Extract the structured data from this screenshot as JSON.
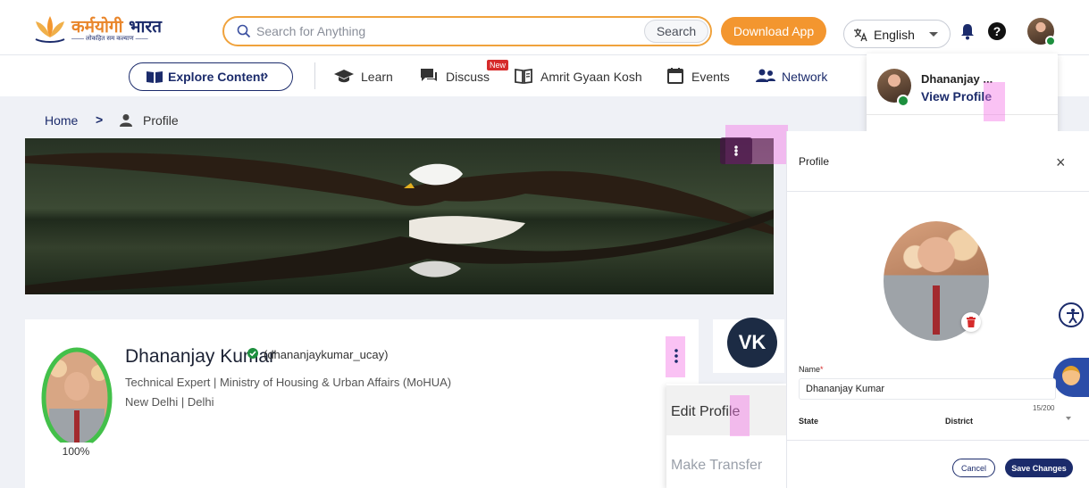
{
  "header": {
    "logo": {
      "title_part1": "कर्मयोगी",
      "title_part2": " भारत",
      "tagline": "—— लोकहित सम कल्याण ——"
    },
    "search": {
      "placeholder": "Search for Anything",
      "button_label": "Search"
    },
    "download_label": "Download App",
    "language": "English"
  },
  "nav": {
    "explore_label": "Explore Content",
    "explore_chevron": "›",
    "items": [
      {
        "label": "Learn",
        "icon": "graduation-cap-icon"
      },
      {
        "label": "Discuss",
        "icon": "discussion-icon",
        "badge": "New"
      },
      {
        "label": "Amrit Gyaan Kosh",
        "icon": "book-icon"
      },
      {
        "label": "Events",
        "icon": "calendar-icon"
      },
      {
        "label": "Network",
        "icon": "people-icon"
      }
    ]
  },
  "breadcrumb": {
    "home": "Home",
    "separator": ">",
    "current": "Profile"
  },
  "profile": {
    "name": "Dhananjay Kumar",
    "handle": "(dhananjaykumar_ucay)",
    "designation": "Technical Expert | Ministry of Housing & Urban Affairs (MoHUA)",
    "location": "New Delhi | Delhi",
    "completion": 100,
    "completion_label": "100%"
  },
  "network_card": {
    "initials": "VK"
  },
  "context_menu": {
    "edit_label": "Edit Profile",
    "transfer_label": "Make Transfer Request"
  },
  "user_menu": {
    "name": "Dhananjay ...",
    "view_profile": "View Profile"
  },
  "panel": {
    "title": "Profile",
    "close_glyph": "×",
    "name_label": "Name",
    "required_mark": "*",
    "name_value": "Dhananjay Kumar",
    "char_count": "15/200",
    "state_label": "State",
    "district_label": "District",
    "cancel_label": "Cancel",
    "save_label": "Save Changes"
  },
  "colors": {
    "brand_navy": "#1b2b6b",
    "accent_orange": "#f3962f",
    "search_border": "#f0a23c",
    "verified_green": "#1d8f3e",
    "progress_green": "#43c04a",
    "delete_red": "#d62b2b",
    "highlight_pink": "#f478e6"
  }
}
